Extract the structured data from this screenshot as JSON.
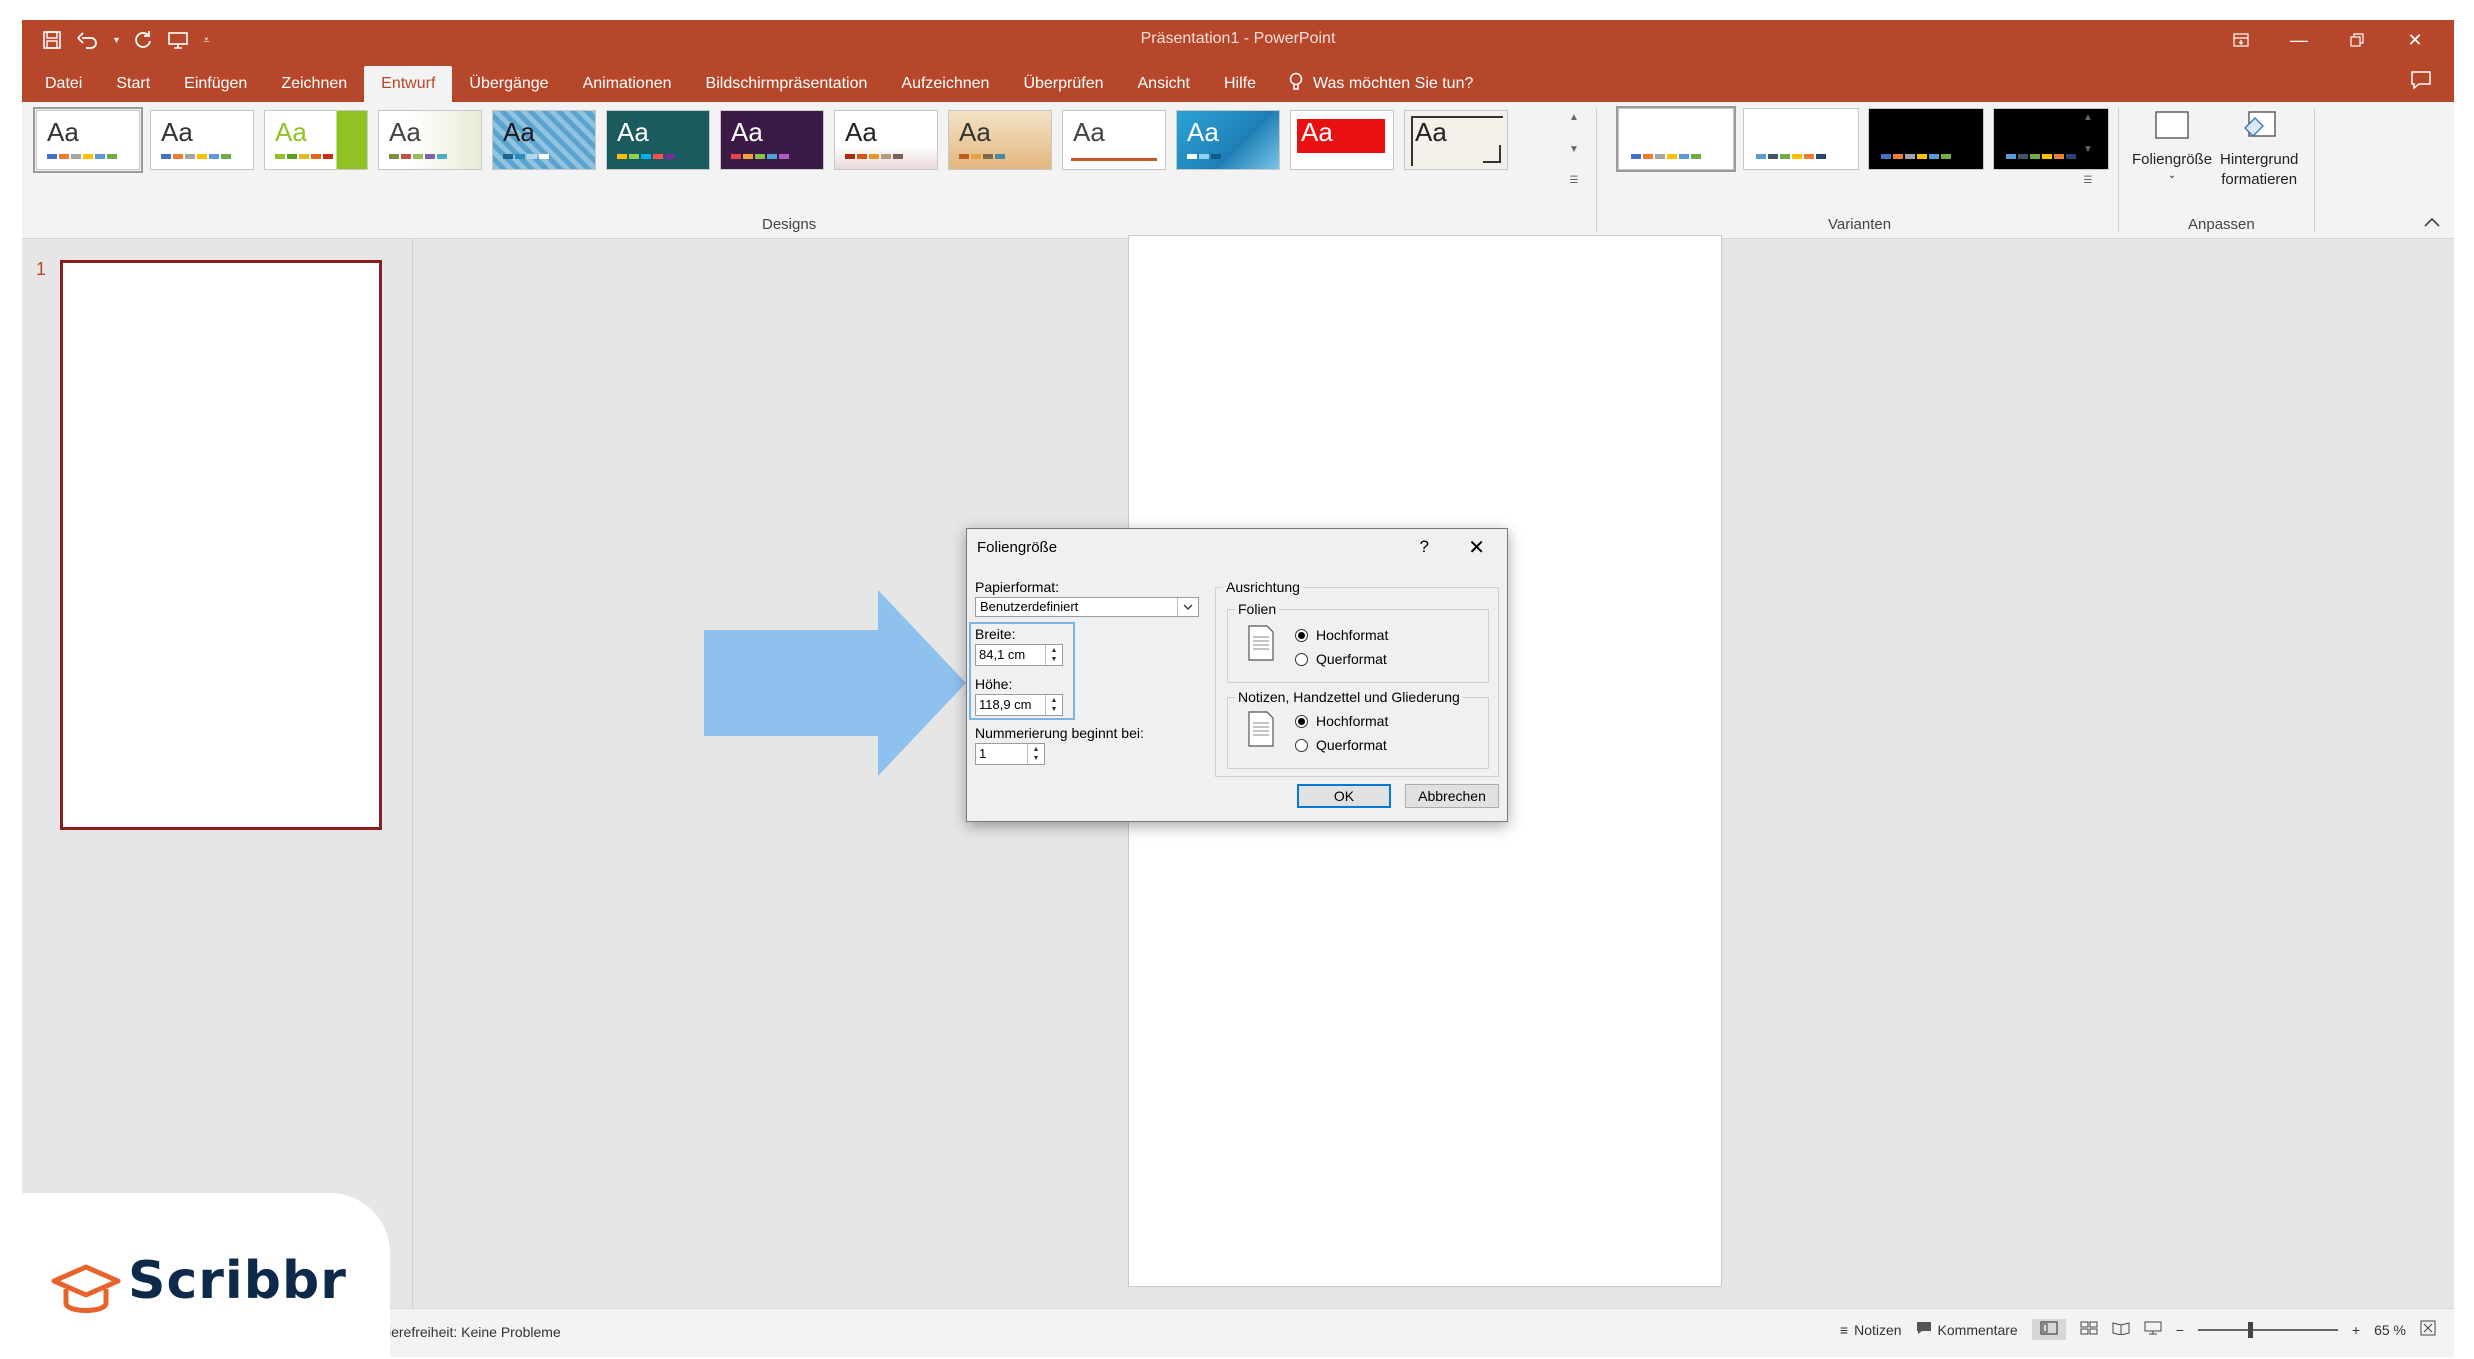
{
  "window": {
    "title": "Präsentation1  -  PowerPoint",
    "qat_items": [
      "save-icon",
      "undo-icon",
      "redo-icon",
      "present-icon",
      "customize-icon"
    ]
  },
  "tabs": [
    "Datei",
    "Start",
    "Einfügen",
    "Zeichnen",
    "Entwurf",
    "Übergänge",
    "Animationen",
    "Bildschirmpräsentation",
    "Aufzeichnen",
    "Überprüfen",
    "Ansicht",
    "Hilfe"
  ],
  "active_tab": "Entwurf",
  "tell_me": "Was möchten Sie tun?",
  "ribbon": {
    "designs_label": "Designs",
    "variants_label": "Varianten",
    "customize_label": "Anpassen",
    "slide_size_label": "Foliengröße",
    "format_background_label_1": "Hintergrund",
    "format_background_label_2": "formatieren",
    "theme_text": "Aa"
  },
  "thumbnails": {
    "slide_number": "1"
  },
  "dialog": {
    "title": "Foliengröße",
    "help": "?",
    "close": "✕",
    "paper_format_label": "Papierformat:",
    "paper_format_value": "Benutzerdefiniert",
    "width_label": "Breite:",
    "width_value": "84,1 cm",
    "height_label": "Höhe:",
    "height_value": "118,9 cm",
    "numbering_label": "Nummerierung beginnt bei:",
    "numbering_value": "1",
    "orientation_label": "Ausrichtung",
    "slides_group_label": "Folien",
    "notes_group_label": "Notizen, Handzettel und Gliederung",
    "portrait": "Hochformat",
    "landscape": "Querformat",
    "slides_orientation": "Hochformat",
    "notes_orientation": "Hochformat",
    "ok": "OK",
    "cancel": "Abbrechen"
  },
  "status": {
    "accessibility": "ierefreiheit: Keine Probleme",
    "notes": "Notizen",
    "comments": "Kommentare",
    "zoom_minus": "−",
    "zoom_plus": "+",
    "zoom": "65 %"
  },
  "watermark": {
    "brand": "Scribbr"
  },
  "colors": {
    "accent": "#b7472a",
    "highlight_arrow": "#8fc1ee",
    "dialog_highlight": "#7cb4e6",
    "thumbnail_border": "#8b1d1d"
  }
}
